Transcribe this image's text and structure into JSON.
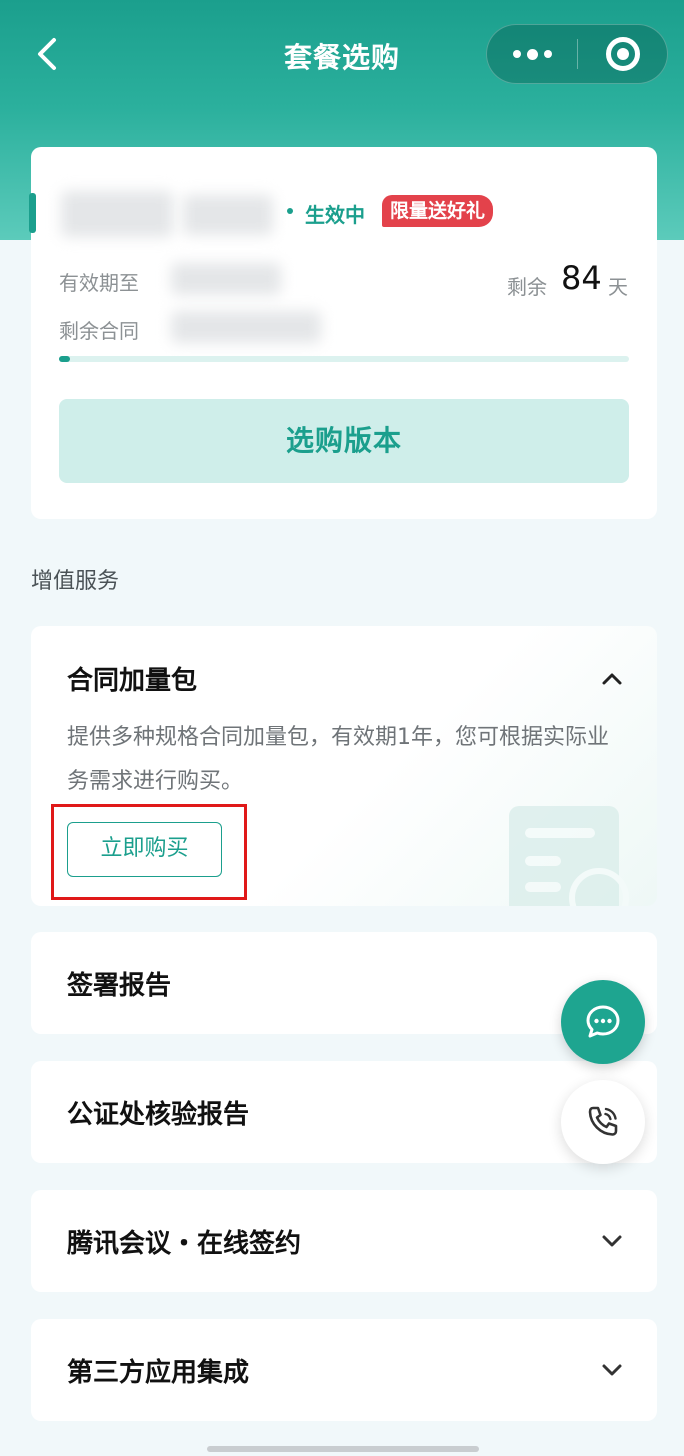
{
  "nav": {
    "title": "套餐选购",
    "icons": {
      "back": "back-arrow-icon",
      "more": "more-dots-icon",
      "close": "close-ring-icon"
    }
  },
  "plan": {
    "status": "生效中",
    "promo_badge": "限量送好礼",
    "expiry_label": "有效期至",
    "contracts_label": "剩余合同",
    "remaining_label": "剩余",
    "remaining_days": "84",
    "remaining_unit": "天",
    "progress_fraction": 0.02,
    "buy_version_button": "选购版本"
  },
  "value_added": {
    "section_title": "增值服务",
    "addon": {
      "title": "合同加量包",
      "description": "提供多种规格合同加量包，有效期1年，您可根据实际业务需求进行购买。",
      "buy_button": "立即购买",
      "expanded": true
    },
    "services": [
      {
        "label": "签署报告"
      },
      {
        "label": "公证处核验报告"
      },
      {
        "label": "腾讯会议・在线签约"
      },
      {
        "label": "第三方应用集成"
      }
    ]
  },
  "floating": {
    "chat_icon": "chat-bubble-icon",
    "phone_icon": "phone-call-icon"
  },
  "colors": {
    "brand": "#1b9f8d",
    "promo": "#e3424b",
    "highlight": "#e01818"
  }
}
